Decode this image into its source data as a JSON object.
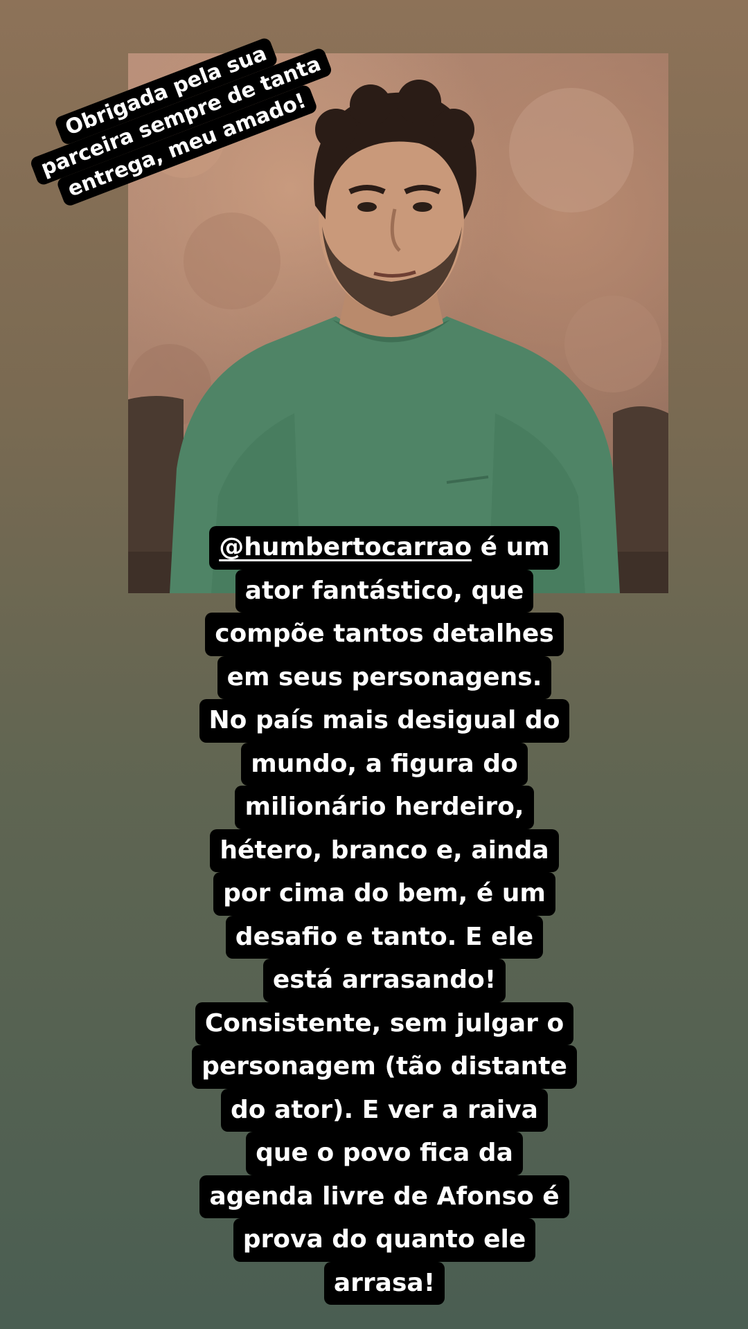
{
  "story": {
    "sticker_lines": [
      "Obrigada pela sua",
      "parceira sempre de tanta",
      "entrega, meu amado!"
    ],
    "mention": "@humbertocarrao",
    "caption_first_rest": " é um",
    "caption_lines": [
      "ator fantástico, que",
      "compõe tantos detalhes",
      "em seus personagens.",
      "No país mais desigual do",
      "mundo, a figura do",
      "milionário herdeiro,",
      "hétero, branco e, ainda",
      "por cima do bem, é um",
      "desafio e tanto. E ele",
      "está arrasando!",
      "Consistente, sem julgar o",
      "personagem (tão distante",
      "do ator). E ver a raiva",
      "que o povo fica da",
      "agenda livre de Afonso é",
      "prova do quanto ele",
      "arrasa!"
    ]
  },
  "colors": {
    "background_top": "#8d7258",
    "background_bottom": "#4a5e52",
    "text_box": "#000000",
    "text": "#ffffff",
    "sweater": "#4f8466"
  }
}
